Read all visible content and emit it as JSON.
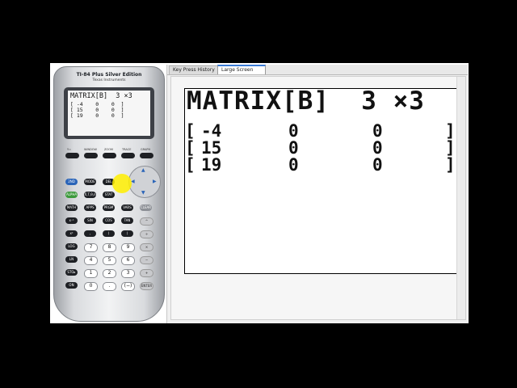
{
  "calculator": {
    "brand": "TI-84 Plus Silver Edition",
    "maker": "Texas Instruments",
    "screen": {
      "title": "MATRIX[B]  3 ×3",
      "rows": [
        "[ -4    0    0  ]",
        "[ 15    0    0  ]",
        "[ 19    0    0  ]"
      ]
    },
    "fn_labels": [
      "Y=",
      "WINDOW",
      "ZOOM",
      "TRACE",
      "GRAPH"
    ],
    "keys": {
      "row1": [
        "2ND",
        "MODE",
        "DEL"
      ],
      "row2": [
        "ALPHA",
        "X,T,θ,n",
        "STAT"
      ],
      "row3": [
        "MATH",
        "APPS",
        "PRGM",
        "VARS",
        "CLEAR"
      ],
      "row4": [
        "x⁻¹",
        "SIN",
        "COS",
        "TAN",
        "^"
      ],
      "row5": [
        "x²",
        ",",
        "(",
        ")",
        "÷"
      ],
      "row6": [
        "LOG",
        "7",
        "8",
        "9",
        "×"
      ],
      "row7": [
        "LN",
        "4",
        "5",
        "6",
        "−"
      ],
      "row8": [
        "STO▸",
        "1",
        "2",
        "3",
        "+"
      ],
      "row9": [
        "ON",
        "0",
        ".",
        "(−)",
        "ENTER"
      ]
    }
  },
  "panel": {
    "tabs": [
      {
        "label": "Key Press History",
        "active": false
      },
      {
        "label": "Large Screen",
        "active": true
      }
    ],
    "large_screen": {
      "title": "MATRIX[B]  3 ×3",
      "rows": [
        [
          "-4",
          "0",
          "0"
        ],
        [
          "15",
          "0",
          "0"
        ],
        [
          "19",
          "0",
          "0"
        ]
      ]
    }
  },
  "colors": {
    "accent_tab": "#3a7bd5",
    "highlight": "#ffee00",
    "key_dark": "#1e2024",
    "key_blue": "#2a64b8",
    "key_green": "#3c9a3c"
  }
}
